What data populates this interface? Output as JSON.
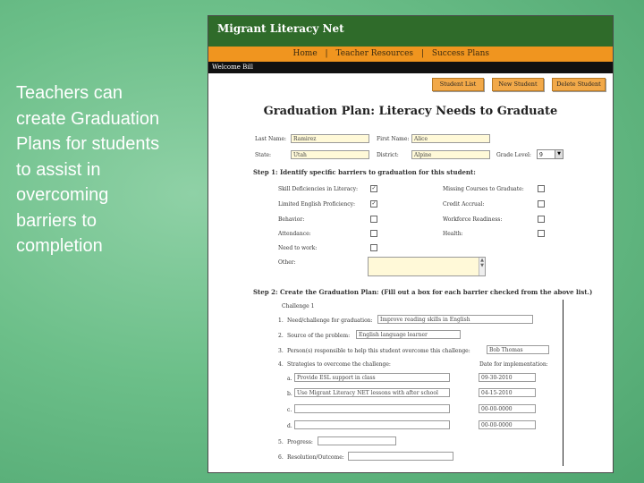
{
  "caption": "Teachers can create Graduation Plans for students to assist in overcoming barriers to completion",
  "app": {
    "name": "Migrant Literacy Net",
    "nav": [
      "Home",
      "|",
      "Teacher Resources",
      "|",
      "Success Plans"
    ],
    "welcome": "Welcome Bill"
  },
  "toolbar": {
    "student_list": "Student List",
    "new_student": "New Student",
    "delete_student": "Delete Student"
  },
  "page_title": "Graduation Plan: Literacy Needs to Graduate",
  "student": {
    "last_name_label": "Last Name:",
    "last_name": "Ramirez",
    "first_name_label": "First Name:",
    "first_name": "Alice",
    "state_label": "State:",
    "state": "Utah",
    "district_label": "District:",
    "district": "Alpine",
    "grade_label": "Grade Level:",
    "grade": "9"
  },
  "step1": {
    "heading": "Step 1: Identify specific barriers to graduation for this student:",
    "left": [
      {
        "label": "Skill Deficiencies in Literacy:",
        "checked": "✓"
      },
      {
        "label": "Limited English Proficiency:",
        "checked": "✓"
      },
      {
        "label": "Behavior:",
        "checked": ""
      },
      {
        "label": "Attendance:",
        "checked": ""
      },
      {
        "label": "Need to work:",
        "checked": ""
      }
    ],
    "right": [
      {
        "label": "Missing Courses to Graduate:",
        "checked": ""
      },
      {
        "label": "Credit Accrual:",
        "checked": ""
      },
      {
        "label": "Workforce Readiness:",
        "checked": ""
      },
      {
        "label": "Health:",
        "checked": ""
      }
    ],
    "other_label": "Other:"
  },
  "step2": {
    "heading": "Step 2: Create the Graduation Plan: (Fill out a box for each barrier checked from the above list.)",
    "challenge": "Challenge 1",
    "q1_label": "Need/challenge for graduation:",
    "q1": "Improve reading skills in English",
    "q2_label": "Source of the problem:",
    "q2": "English language learner",
    "q3_label": "Person(s) responsible to help this student overcome this challenge:",
    "q3": "Bob Thomas",
    "q4_label": "Strategies to overcome the challenge:",
    "dates_label": "Date for implementation:",
    "strategies": [
      {
        "letter": "a.",
        "text": "Provide ESL support in class",
        "date": "09-30-2010"
      },
      {
        "letter": "b.",
        "text": "Use Migrant Literacy NET lessons with after school tutors",
        "date": "04-15-2010"
      },
      {
        "letter": "c.",
        "text": "",
        "date": "00-00-0000"
      },
      {
        "letter": "d.",
        "text": "",
        "date": "00-00-0000"
      }
    ],
    "q5_label": "Progress:",
    "q6_label": "Resolution/Outcome:",
    "nums": [
      "1.",
      "2.",
      "3.",
      "4.",
      "5.",
      "6."
    ]
  }
}
